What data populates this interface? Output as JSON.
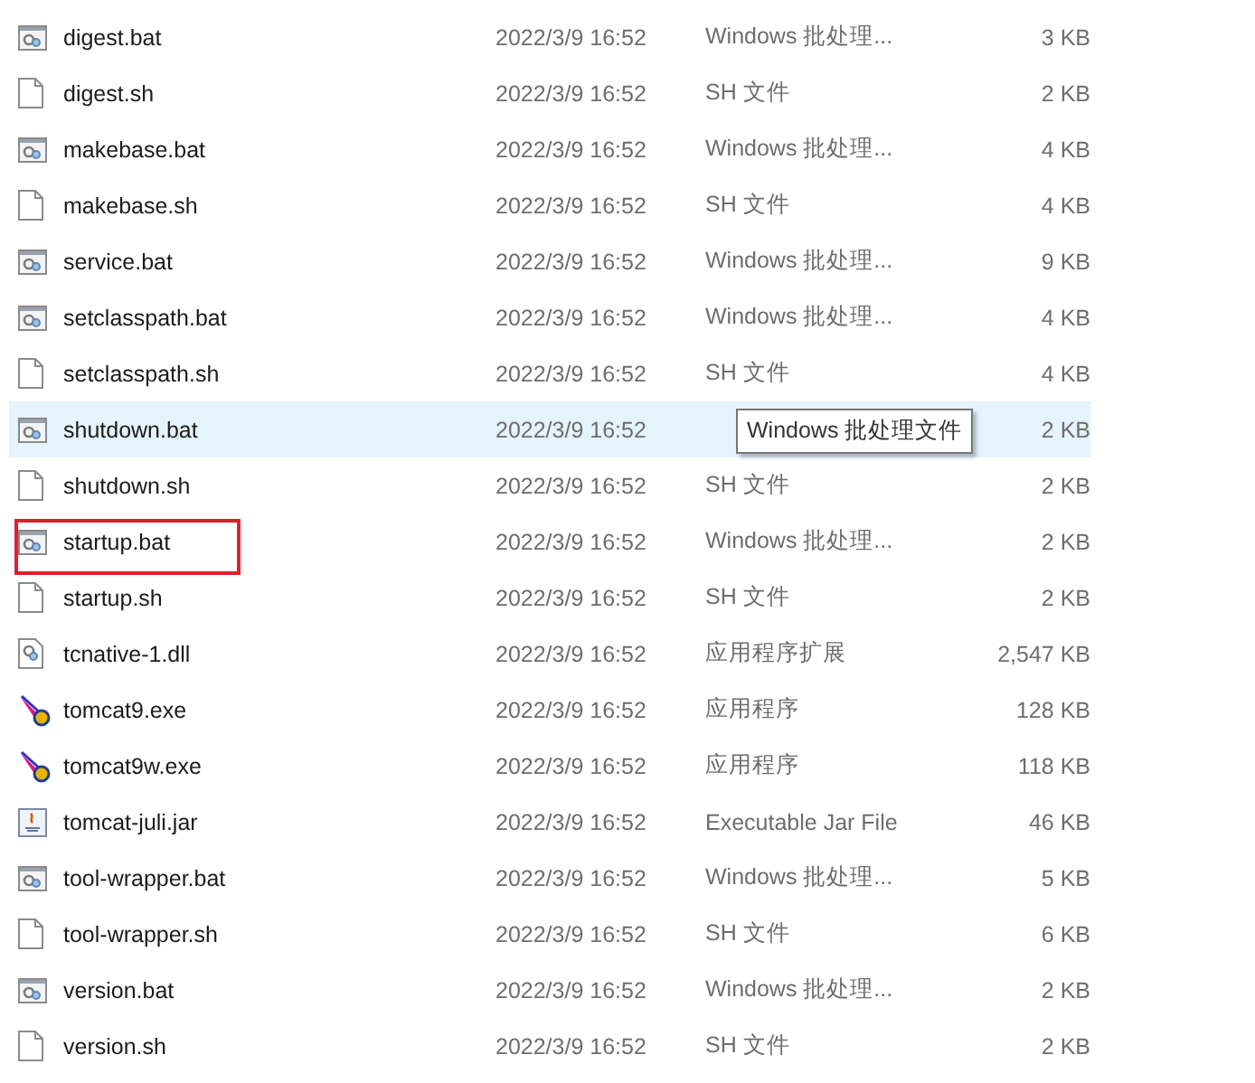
{
  "files": [
    {
      "name": "digest.bat",
      "kind": "bat",
      "modified": "2022/3/9 16:52",
      "type": "Windows 批处理...",
      "size": "3 KB",
      "hovered": false,
      "outlined": false
    },
    {
      "name": "digest.sh",
      "kind": "sh",
      "modified": "2022/3/9 16:52",
      "type": "SH 文件",
      "size": "2 KB",
      "hovered": false,
      "outlined": false
    },
    {
      "name": "makebase.bat",
      "kind": "bat",
      "modified": "2022/3/9 16:52",
      "type": "Windows 批处理...",
      "size": "4 KB",
      "hovered": false,
      "outlined": false
    },
    {
      "name": "makebase.sh",
      "kind": "sh",
      "modified": "2022/3/9 16:52",
      "type": "SH 文件",
      "size": "4 KB",
      "hovered": false,
      "outlined": false
    },
    {
      "name": "service.bat",
      "kind": "bat",
      "modified": "2022/3/9 16:52",
      "type": "Windows 批处理...",
      "size": "9 KB",
      "hovered": false,
      "outlined": false
    },
    {
      "name": "setclasspath.bat",
      "kind": "bat",
      "modified": "2022/3/9 16:52",
      "type": "Windows 批处理...",
      "size": "4 KB",
      "hovered": false,
      "outlined": false
    },
    {
      "name": "setclasspath.sh",
      "kind": "sh",
      "modified": "2022/3/9 16:52",
      "type": "SH 文件",
      "size": "4 KB",
      "hovered": false,
      "outlined": false
    },
    {
      "name": "shutdown.bat",
      "kind": "bat",
      "modified": "2022/3/9 16:52",
      "tooltip": "Windows 批处理文件",
      "size": "2 KB",
      "hovered": true,
      "outlined": false
    },
    {
      "name": "shutdown.sh",
      "kind": "sh",
      "modified": "2022/3/9 16:52",
      "type": "SH 文件",
      "size": "2 KB",
      "hovered": false,
      "outlined": false
    },
    {
      "name": "startup.bat",
      "kind": "bat",
      "modified": "2022/3/9 16:52",
      "type": "Windows 批处理...",
      "size": "2 KB",
      "hovered": false,
      "outlined": true
    },
    {
      "name": "startup.sh",
      "kind": "sh",
      "modified": "2022/3/9 16:52",
      "type": "SH 文件",
      "size": "2 KB",
      "hovered": false,
      "outlined": false
    },
    {
      "name": "tcnative-1.dll",
      "kind": "dll",
      "modified": "2022/3/9 16:52",
      "type": "应用程序扩展",
      "size": "2,547 KB",
      "hovered": false,
      "outlined": false
    },
    {
      "name": "tomcat9.exe",
      "kind": "exe",
      "modified": "2022/3/9 16:52",
      "type": "应用程序",
      "size": "128 KB",
      "hovered": false,
      "outlined": false
    },
    {
      "name": "tomcat9w.exe",
      "kind": "exe",
      "modified": "2022/3/9 16:52",
      "type": "应用程序",
      "size": "118 KB",
      "hovered": false,
      "outlined": false
    },
    {
      "name": "tomcat-juli.jar",
      "kind": "jar",
      "modified": "2022/3/9 16:52",
      "type": "Executable Jar File",
      "size": "46 KB",
      "hovered": false,
      "outlined": false
    },
    {
      "name": "tool-wrapper.bat",
      "kind": "bat",
      "modified": "2022/3/9 16:52",
      "type": "Windows 批处理...",
      "size": "5 KB",
      "hovered": false,
      "outlined": false
    },
    {
      "name": "tool-wrapper.sh",
      "kind": "sh",
      "modified": "2022/3/9 16:52",
      "type": "SH 文件",
      "size": "6 KB",
      "hovered": false,
      "outlined": false
    },
    {
      "name": "version.bat",
      "kind": "bat",
      "modified": "2022/3/9 16:52",
      "type": "Windows 批处理...",
      "size": "2 KB",
      "hovered": false,
      "outlined": false
    },
    {
      "name": "version.sh",
      "kind": "sh",
      "modified": "2022/3/9 16:52",
      "type": "SH 文件",
      "size": "2 KB",
      "hovered": false,
      "outlined": false
    }
  ]
}
